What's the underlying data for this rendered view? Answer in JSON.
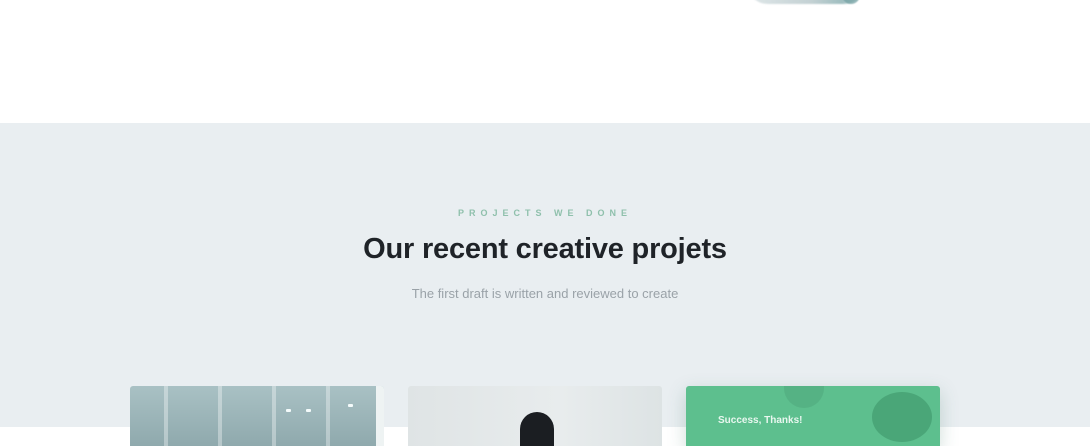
{
  "projects": {
    "eyebrow": "PROJECTS WE DONE",
    "title": "Our recent creative projets",
    "subtitle": "The first draft is written and reviewed to create"
  },
  "cards": [
    {
      "kind": "office-photo"
    },
    {
      "kind": "person-photo"
    },
    {
      "kind": "green-overlay",
      "label": "Success, Thanks!"
    }
  ],
  "colors": {
    "section_background": "#e9eef1",
    "accent": "#8fc0ac",
    "card_green": "#5dbf8e",
    "title": "#1f2328",
    "subtitle": "#9aa2a8"
  }
}
